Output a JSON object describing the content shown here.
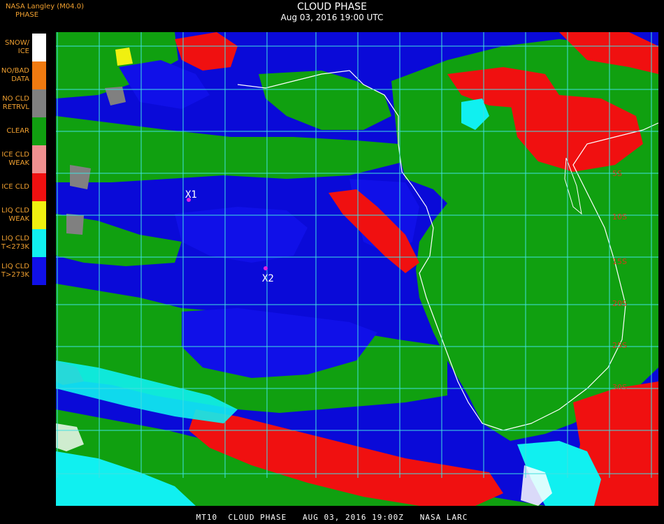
{
  "header": {
    "source": "NASA Langley (M04.0)",
    "legend_title": "PHASE",
    "title": "CLOUD PHASE",
    "datetime": "Aug 03, 2016 19:00 UTC"
  },
  "legend": [
    {
      "label": "SNOW/\nICE",
      "color": "#ffffff"
    },
    {
      "label": "NO/BAD\nDATA",
      "color": "#f07a10"
    },
    {
      "label": "NO CLD\nRETRVL",
      "color": "#808080"
    },
    {
      "label": "CLEAR",
      "color": "#10a010"
    },
    {
      "label": "ICE CLD\nWEAK",
      "color": "#f09090"
    },
    {
      "label": "ICE CLD",
      "color": "#f01010"
    },
    {
      "label": "LIQ CLD\nWEAK",
      "color": "#f0f010"
    },
    {
      "label": "LIQ CLD\nT<273K",
      "color": "#10f0f0"
    },
    {
      "label": "LIQ CLD\nT>273K",
      "color": "#1010e8"
    }
  ],
  "markers": [
    {
      "label": "X1",
      "color": "#e020e0"
    },
    {
      "label": "X2",
      "color": "#e020e0"
    }
  ],
  "lat_labels": [
    "5S",
    "10S",
    "15S",
    "20S",
    "25S",
    "30S"
  ],
  "footer": "MT10  CLOUD PHASE   AUG 03, 2016 19:00Z   NASA LARC",
  "colors": {
    "liquid_warm": "#1010e8",
    "clear": "#10a010",
    "ice": "#f01010",
    "liquid_cold": "#10f0f0",
    "grid": "#40e0e0",
    "coast": "#ffffff"
  }
}
